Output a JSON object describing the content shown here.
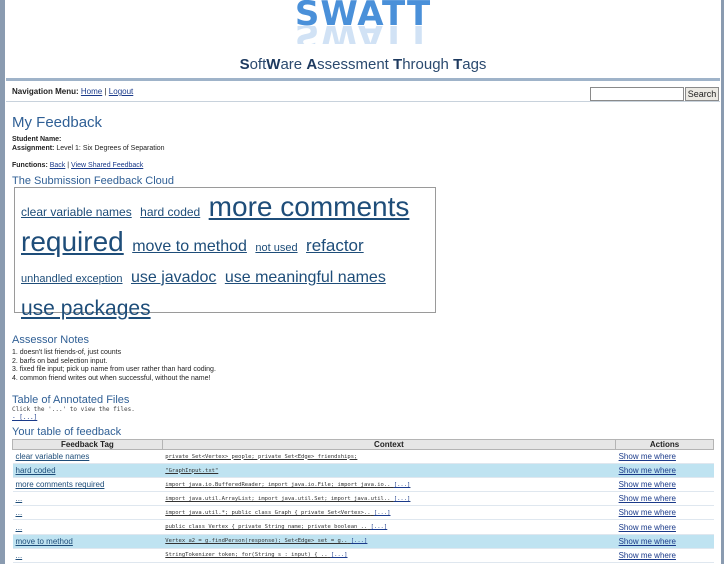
{
  "header": {
    "logo": "SWATT",
    "tagline_parts": [
      {
        "b": "S",
        "t": "oft"
      },
      {
        "b": "W",
        "t": "are "
      },
      {
        "b": "A",
        "t": "ssessment "
      },
      {
        "b": "T",
        "t": "hrough "
      },
      {
        "b": "T",
        "t": "ags"
      }
    ]
  },
  "nav": {
    "label": "Navigation Menu:",
    "home": "Home",
    "sep": "|",
    "logout": "Logout",
    "search_value": "",
    "search_button": "Search"
  },
  "page": {
    "title": "My Feedback",
    "student_label": "Student Name:",
    "student_value": "",
    "assignment_label": "Assignment:",
    "assignment_value": "Level 1: Six Degrees of Separation",
    "functions_label": "Functions:",
    "back": "Back",
    "functions_sep": "|",
    "shared": "View Shared Feedback"
  },
  "cloud": {
    "title": "The Submission Feedback Cloud",
    "tags": [
      {
        "text": "clear variable names",
        "size": 12
      },
      {
        "text": "hard coded",
        "size": 12
      },
      {
        "text": "more comments",
        "size": 28
      },
      {
        "text": "required",
        "size": 28
      },
      {
        "text": "move to method",
        "size": 16
      },
      {
        "text": "not used",
        "size": 11
      },
      {
        "text": "refactor",
        "size": 17
      },
      {
        "text": "unhandled exception",
        "size": 11
      },
      {
        "text": "use javadoc",
        "size": 16
      },
      {
        "text": "use meaningful names",
        "size": 16
      },
      {
        "text": "use packages",
        "size": 21
      }
    ]
  },
  "notes": {
    "title": "Assessor Notes",
    "lines": [
      "1. doesn't list friends-of, just counts",
      "2. barfs on bad selection input.",
      "3. fixed file input; pick up name from user rather than hard coding.",
      "4. common friend writes out when successful, without the name!"
    ]
  },
  "files": {
    "title": "Table of Annotated Files",
    "caption": "Click the '...' to view the files.",
    "item": "- [...]"
  },
  "table": {
    "title": "Your table of feedback",
    "headers": [
      "Feedback Tag",
      "Context",
      "Actions"
    ],
    "rows": [
      {
        "tag": "clear variable names",
        "ctx": "private Set<Vertex> people; private Set<Edge> friendships;",
        "more": "",
        "action": "Show me where",
        "hl": false
      },
      {
        "tag": "hard coded",
        "ctx": "\"GraphInput.txt\"",
        "more": "",
        "action": "Show me where",
        "hl": true
      },
      {
        "tag": "more comments required",
        "ctx": "import java.io.BufferedReader; import java.io.File; import java.io..",
        "more": "[...]",
        "action": "Show me where",
        "hl": false
      },
      {
        "tag": "...",
        "ctx": "import java.util.ArrayList; import java.util.Set; import java.util..",
        "more": "[...]",
        "action": "Show me where",
        "hl": false
      },
      {
        "tag": "...",
        "ctx": "import java.util.*; public class Graph { private Set<Vertex>..",
        "more": "[...]",
        "action": "Show me where",
        "hl": false
      },
      {
        "tag": "...",
        "ctx": "public class Vertex { private String name; private boolean ..",
        "more": "[...]",
        "action": "Show me where",
        "hl": false
      },
      {
        "tag": "move to method",
        "ctx": "Vertex a2 = g.findPerson(response); Set<Edge> set = g..",
        "more": "[...]",
        "action": "Show me where",
        "hl": true
      },
      {
        "tag": "...",
        "ctx": "StringTokenizer token; for(String s : input) { ..",
        "more": "[...]",
        "action": "Show me where",
        "hl": false
      }
    ]
  }
}
